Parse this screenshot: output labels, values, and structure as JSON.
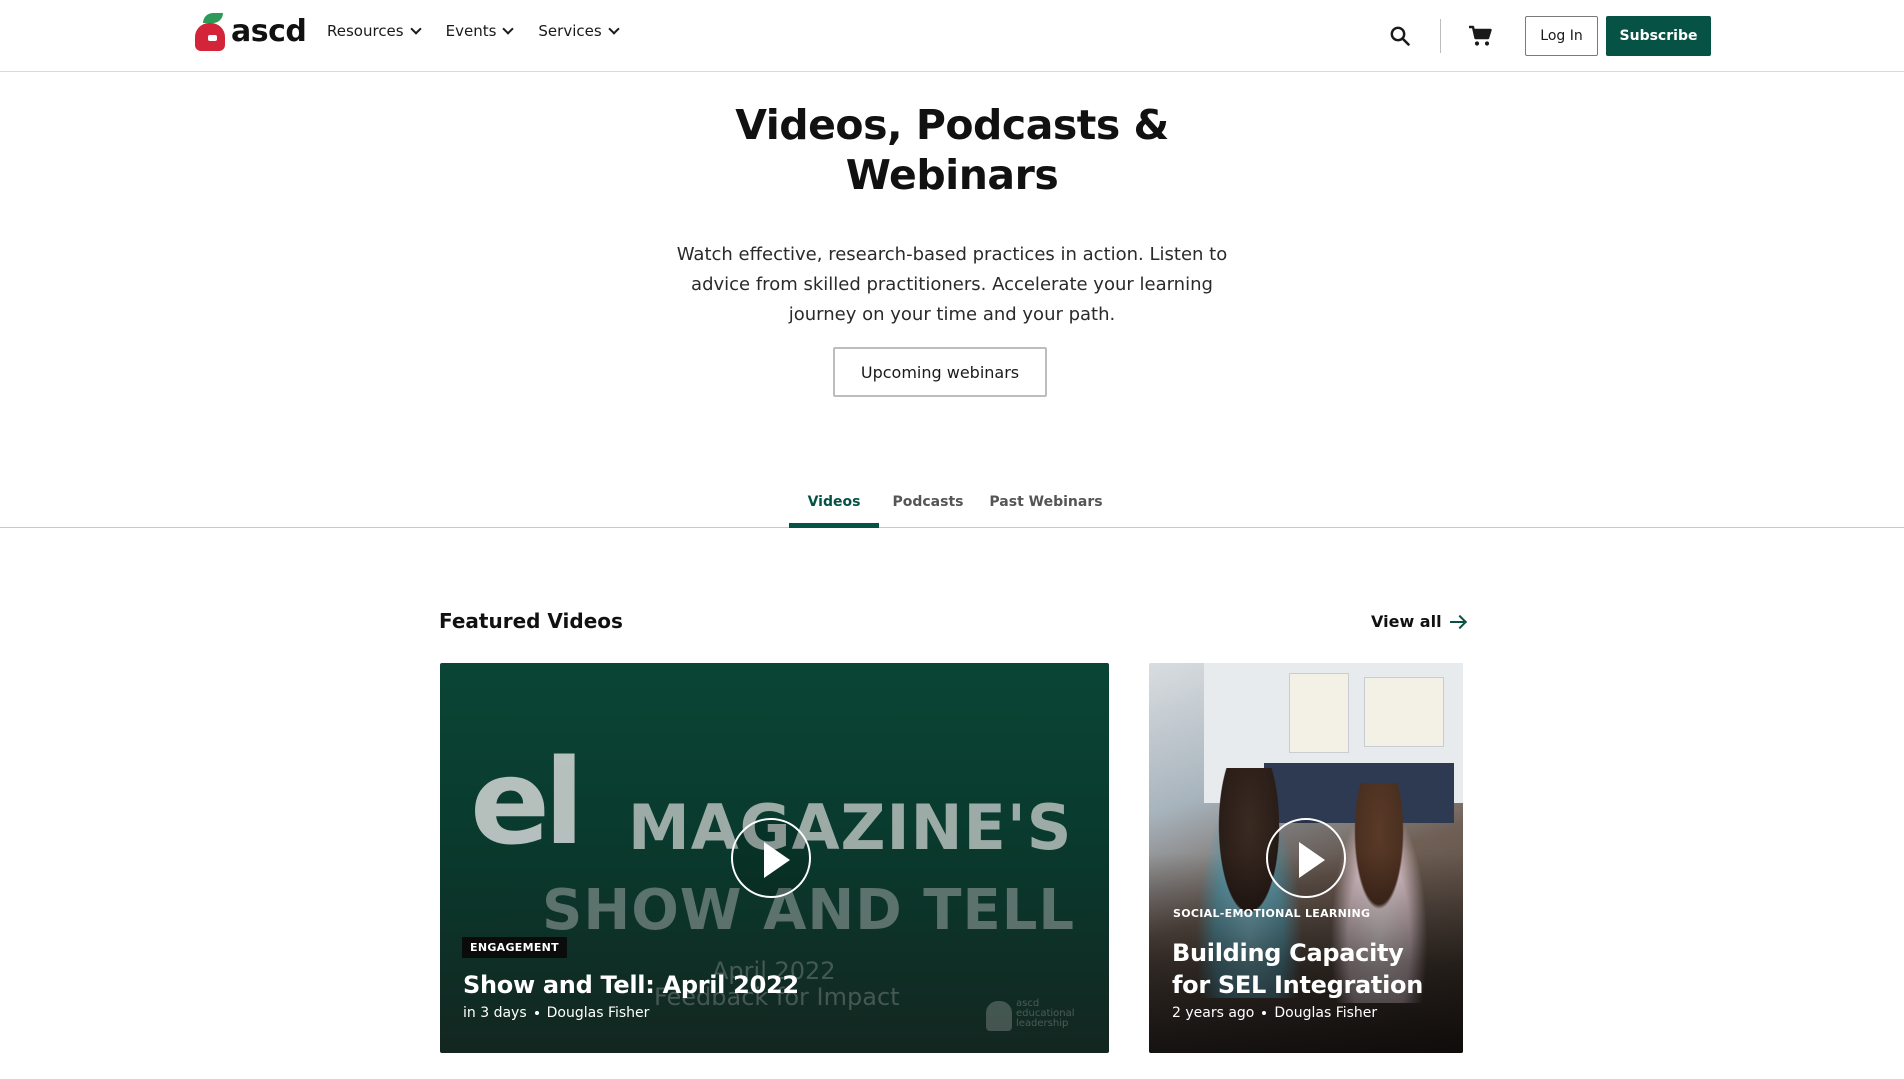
{
  "brand": {
    "logo_text": "ascd",
    "accent": "#065244"
  },
  "nav": {
    "items": [
      {
        "label": "Resources"
      },
      {
        "label": "Events"
      },
      {
        "label": "Services"
      }
    ]
  },
  "header": {
    "search_icon": "search-icon",
    "cart_icon": "cart-icon",
    "login_label": "Log In",
    "subscribe_label": "Subscribe"
  },
  "hero": {
    "title": "Videos, Podcasts & Webinars",
    "description": "Watch effective, research-based practices in action. Listen to advice from skilled practitioners. Accelerate your learning journey on your time and your path.",
    "cta_label": "Upcoming webinars"
  },
  "tabs": [
    {
      "label": "Videos",
      "active": true
    },
    {
      "label": "Podcasts",
      "active": false
    },
    {
      "label": "Past Webinars",
      "active": false
    }
  ],
  "featured": {
    "title": "Featured Videos",
    "view_all_label": "View all",
    "cards": [
      {
        "thumbnail_text": {
          "logo": "el",
          "line1": "MAGAZINE'S",
          "line2": "SHOW AND TELL",
          "date": "April 2022",
          "subtitle": "Feedback for Impact",
          "watermark": "ascd educational leadership"
        },
        "category": "ENGAGEMENT",
        "title": "Show and Tell: April 2022",
        "time": "in 3 days",
        "author": "Douglas Fisher"
      },
      {
        "category": "SOCIAL-EMOTIONAL LEARNING",
        "title": "Building Capacity for SEL Integration",
        "time": "2 years ago",
        "author": "Douglas Fisher"
      }
    ]
  }
}
